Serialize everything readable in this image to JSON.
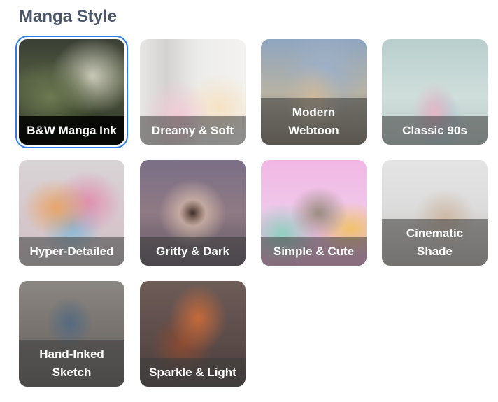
{
  "section": {
    "title": "Manga Style"
  },
  "styles": [
    {
      "label": "B&W Manga Ink",
      "selected": true
    },
    {
      "label": "Dreamy & Soft",
      "selected": false
    },
    {
      "label": "Modern\nWebtoon",
      "selected": false
    },
    {
      "label": "Classic 90s",
      "selected": false
    },
    {
      "label": "Hyper-Detailed",
      "selected": false
    },
    {
      "label": "Gritty & Dark",
      "selected": false
    },
    {
      "label": "Simple & Cute",
      "selected": false
    },
    {
      "label": "Cinematic\nShade",
      "selected": false
    },
    {
      "label": "Hand-Inked\nSketch",
      "selected": false
    },
    {
      "label": "Sparkle & Light",
      "selected": false
    }
  ],
  "colors": {
    "selection_ring": "#2b7de9",
    "title": "#4a5568"
  }
}
